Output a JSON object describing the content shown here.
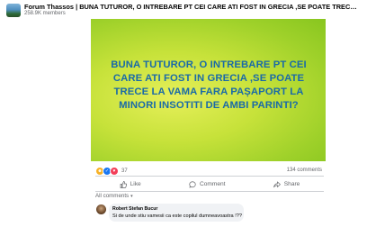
{
  "group": {
    "name": "Forum Thassos | BUNA TUTUROR, O INTREBARE PT CEI CARE ATI FOST IN GRECIA ,SE POATE TRECE LA VAMA FARA PAȘAPORT L...",
    "members": "258.9K members"
  },
  "post": {
    "image_text": "BUNA TUTUROR, O INTREBARE PT CEI CARE ATI FOST IN GRECIA ,SE POATE TRECE LA VAMA FARA PAȘAPORT LA MINORI INSOTITI DE AMBI PARINTI?",
    "reaction_count": "37",
    "comment_count": "134 comments"
  },
  "actions": {
    "like": "Like",
    "comment": "Comment",
    "share": "Share"
  },
  "comments": {
    "filter_label": "All comments",
    "items": [
      {
        "author": "Robert Stefan Bucur",
        "text": "Si de unde stiu vamesii ca este copilul dumneavoastra !??"
      }
    ]
  },
  "colors": {
    "image_text": "#1a6aa8",
    "like_blue": "#1877f2",
    "muted": "#65676b"
  },
  "icons": [
    "group-avatar",
    "haha-icon",
    "like-reaction-icon",
    "love-icon",
    "like-icon",
    "comment-icon",
    "share-icon",
    "chevron-down-icon"
  ]
}
